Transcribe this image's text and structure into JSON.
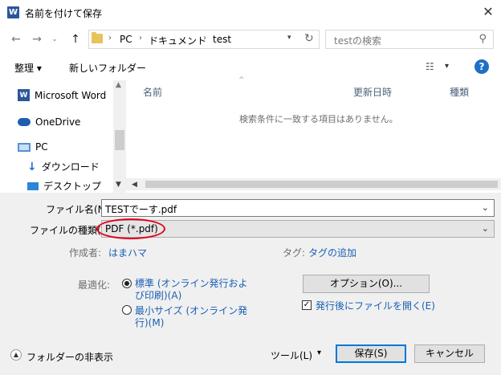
{
  "window": {
    "title": "名前を付けて保存",
    "app_icon": "W"
  },
  "address": {
    "crumbs": [
      "PC",
      "ドキュメント",
      "test"
    ]
  },
  "search": {
    "placeholder": "testの検索"
  },
  "toolbar": {
    "organize": "整理 ▾",
    "new_folder": "新しいフォルダー"
  },
  "nav_pane": {
    "items": [
      {
        "label": "Microsoft Word",
        "icon": "word-icon"
      },
      {
        "label": "OneDrive",
        "icon": "onedrive-icon"
      },
      {
        "label": "PC",
        "icon": "pc-icon"
      },
      {
        "label": "ダウンロード",
        "icon": "download-icon"
      },
      {
        "label": "デスクトップ",
        "icon": "desktop-icon"
      }
    ]
  },
  "file_list": {
    "columns": [
      "名前",
      "更新日時",
      "種類"
    ],
    "empty_message": "検索条件に一致する項目はありません。"
  },
  "form": {
    "filename_label": "ファイル名(N):",
    "filename_value": "TESTでーす.pdf",
    "filetype_label": "ファイルの種類(T):",
    "filetype_value": "PDF (*.pdf)",
    "author_label": "作成者:",
    "author_value": "はまハマ",
    "tags_label": "タグ:",
    "tags_value": "タグの追加",
    "optimize_label": "最適化:",
    "opt_standard": "標準 (オンライン発行および印刷)(A)",
    "opt_standard_l1": "標準 (オンライン発行およ",
    "opt_standard_l2": "び印刷)(A)",
    "opt_min_l1": "最小サイズ (オンライン発",
    "opt_min_l2": "行)(M)",
    "options_button": "オプション(O)...",
    "open_after": "発行後にファイルを開く(E)"
  },
  "footer": {
    "hide_folders": "フォルダーの非表示",
    "tools": "ツール(L)",
    "save": "保存(S)",
    "cancel": "キャンセル"
  },
  "colors": {
    "accent": "#0078d7",
    "highlight_ellipse": "#e3001b",
    "link": "#1a5fb4"
  }
}
